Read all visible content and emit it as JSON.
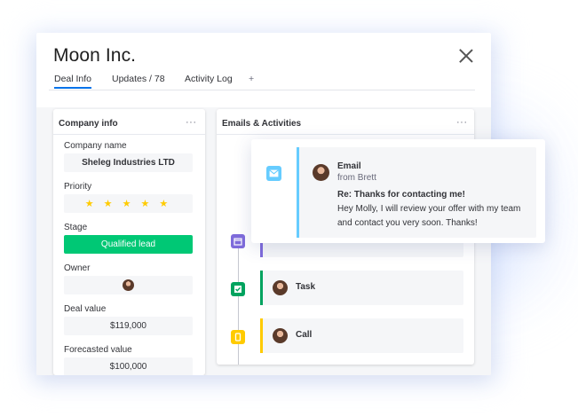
{
  "window": {
    "title": "Moon Inc.",
    "tabs": [
      {
        "label": "Deal Info",
        "active": true
      },
      {
        "label": "Updates / 78"
      },
      {
        "label": "Activity Log"
      },
      {
        "label": "+"
      }
    ]
  },
  "company_card": {
    "header": "Company info",
    "menu": "···",
    "fields": {
      "company_name": {
        "label": "Company name",
        "value": "Sheleg Industries LTD"
      },
      "priority": {
        "label": "Priority",
        "value": "★ ★ ★ ★ ★",
        "rating": 5
      },
      "stage": {
        "label": "Stage",
        "value": "Qualified lead"
      },
      "owner": {
        "label": "Owner"
      },
      "deal_value": {
        "label": "Deal value",
        "value": "$119,000"
      },
      "forecasted_value": {
        "label": "Forecasted value",
        "value": "$100,000"
      }
    }
  },
  "activities_card": {
    "header": "Emails & Activities",
    "menu": "···",
    "items": [
      {
        "type": "Task",
        "icon": "checkbox-icon",
        "color": "#00a35f"
      },
      {
        "type": "Call",
        "icon": "phone-icon",
        "color": "#ffcb00"
      }
    ],
    "meeting_icon_color": "#7e6bdb"
  },
  "email_popup": {
    "type": "Email",
    "from": "from Brett",
    "subject": "Re: Thanks for contacting me!",
    "body_line1": "Hey Molly, I will review your offer with my team",
    "body_line2": "and contact you very soon. Thanks!",
    "icon_color": "#66ccff"
  },
  "colors": {
    "accent": "#0073ea",
    "stage_green": "#00c875",
    "star": "#ffcb00"
  }
}
